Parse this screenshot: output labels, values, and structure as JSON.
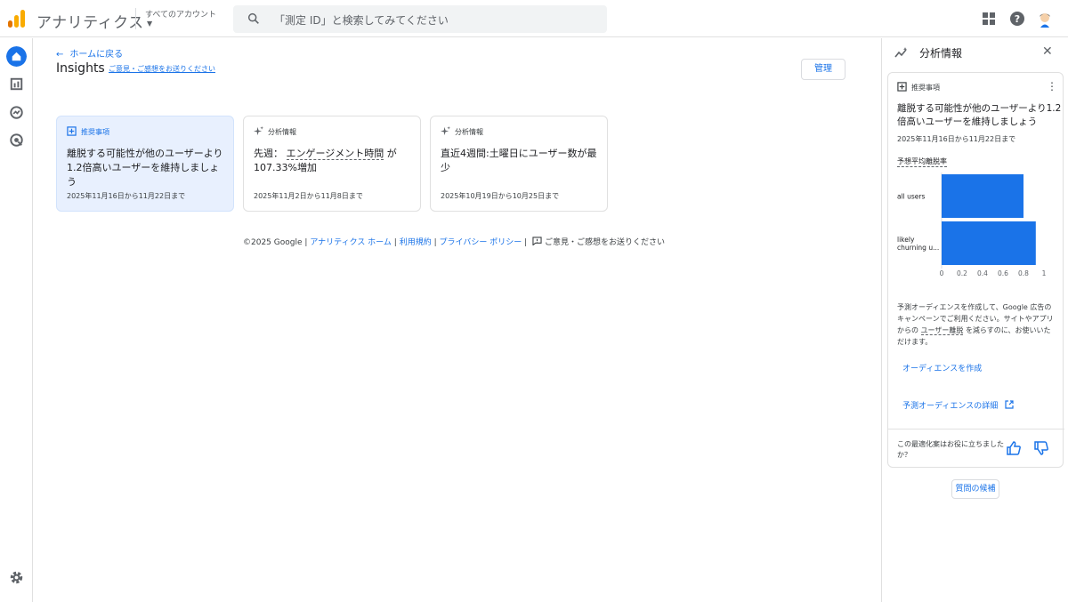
{
  "app": {
    "title": "アナリティクス",
    "account_label": "すべてのアカウント",
    "search_placeholder": "「測定 ID」と検索してみてください"
  },
  "colors": {
    "accent": "#1a73e8",
    "logo_orange": "#f9ab00",
    "logo_dark": "#e37400",
    "bar": "#1a73e8"
  },
  "nav": {
    "back_label": "ホームに戻る",
    "page_title": "Insights",
    "feedback_link": "ご意見・ご感想をお送りください",
    "manage_button": "管理"
  },
  "cards": [
    {
      "chip": "推奨事項",
      "title": "離脱する可能性が他のユーザーより1.2倍高いユーザーを維持しましょう",
      "date": "2025年11月16日から11月22日まで"
    },
    {
      "chip": "分析情報",
      "title_prefix": "先週：",
      "title_term": "エンゲージメント時間",
      "title_suffix": "が107.33%増加",
      "date": "2025年11月2日から11月8日まで"
    },
    {
      "chip": "分析情報",
      "title": "直近4週間:土曜日にユーザー数が最少",
      "date": "2025年10月19日から10月25日まで"
    }
  ],
  "footer": {
    "copyright": "©2025 Google",
    "sep": "|",
    "link1": "アナリティクス ホーム",
    "link2": "利用規約",
    "link3": "プライバシー ポリシー",
    "feedback": "ご意見・ご感想をお送りください"
  },
  "panel": {
    "title": "分析情報",
    "chip": "推奨事項",
    "card_title": "離脱する可能性が他のユーザーより1.2倍高いユーザーを維持しましょう",
    "date": "2025年11月16日から11月22日まで",
    "metric": "予想平均離脱率",
    "desc_1": "予測オーディエンスを作成して、Google 広告のキャンペーンでご利用ください。サイトやアプリからの",
    "desc_term": "ユーザー離脱",
    "desc_2": "を減らすのに、お使いいただけます。",
    "action_create": "オーディエンスを作成",
    "action_detail": "予測オーディエンスの詳細",
    "question": "この最適化案はお役に立ちましたか？",
    "suggest_button": "質問の候補"
  },
  "chart_data": {
    "type": "bar",
    "orientation": "horizontal",
    "categories": [
      "all users",
      "likely churning u..."
    ],
    "values": [
      0.8,
      0.92
    ],
    "xlim": [
      0,
      1
    ],
    "xticks": [
      "0",
      "0.2",
      "0.4",
      "0.6",
      "0.8",
      "1"
    ]
  }
}
